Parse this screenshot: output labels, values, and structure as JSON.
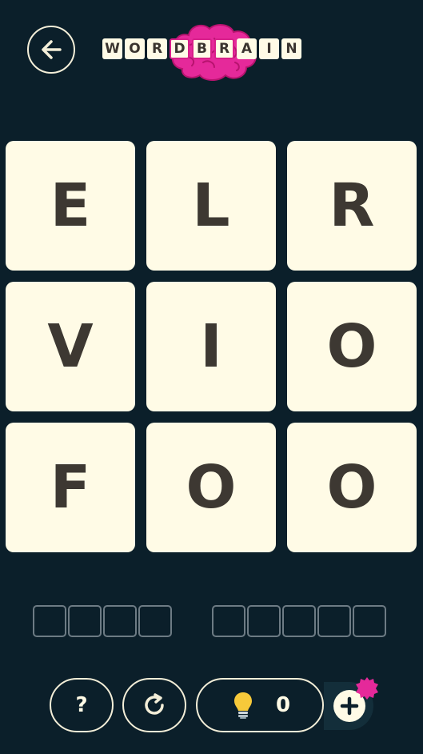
{
  "header": {
    "back_icon": "arrow-left-icon",
    "logo_letters": [
      "W",
      "O",
      "R",
      "D",
      "B",
      "R",
      "A",
      "I",
      "N"
    ],
    "logo_color": "#e5299a"
  },
  "board": {
    "tiles": [
      "E",
      "L",
      "R",
      "V",
      "I",
      "O",
      "F",
      "O",
      "O"
    ]
  },
  "answer_slots": {
    "word_lengths": [
      4,
      5
    ]
  },
  "toolbar": {
    "help_label": "?",
    "restart_icon": "restart-icon",
    "hint_icon": "lightbulb-icon",
    "hint_count": "0",
    "add_icon": "plus-icon"
  },
  "colors": {
    "background": "#0b1f2a",
    "tile": "#fffbe6",
    "letter": "#3d3832",
    "accent": "#e5299a"
  }
}
